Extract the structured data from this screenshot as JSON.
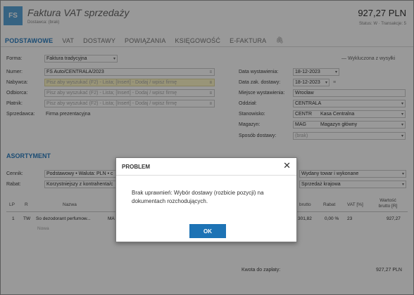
{
  "header": {
    "logo": "FS",
    "title": "Faktura VAT sprzedaży",
    "status": "Dostawca: (brak)",
    "amount": "927,27 PLN",
    "amount_sub": "Status: W · Transakcje: 5"
  },
  "tabs": [
    {
      "label": "PODSTAWOWE"
    },
    {
      "label": "VAT"
    },
    {
      "label": "DOSTAWY"
    },
    {
      "label": "POWIĄZANIA"
    },
    {
      "label": "KSIĘGOWOŚĆ"
    },
    {
      "label": "E-FAKTURA"
    }
  ],
  "left_form": {
    "forma_label": "Forma:",
    "forma_value": "Faktura tradycyjna",
    "numer_label": "Numer:",
    "numer_value": "FS Auto/CENTRALA/2023",
    "nabywca_label": "Nabywca:",
    "nabywca_placeholder": "Pisz aby wyszukać (F2) - Lista; [Insert] - Dodaj / wpisz firmę",
    "odbiorca_label": "Odbiorca:",
    "odbiorca_placeholder": "Pisz aby wyszukać (F2) - Lista; [Insert] - Dodaj / wpisz firmę",
    "platnik_label": "Płatnik:",
    "platnik_placeholder": "Pisz aby wyszukać (F2) - Lista; [Insert] - Dodaj / wpisz firmę",
    "sprzedawca_label": "Sprzedawca:",
    "sprzedawca_value": "Firma prezentacyjna"
  },
  "right_form": {
    "wykluczona": "— Wykluczona z wysyłki",
    "data_wyst_label": "Data wystawienia:",
    "data_wyst_value": "18-12-2023",
    "data_zak_label": "Data zak. dostawy:",
    "data_zak_value": "18-12-2023",
    "miejsce_label": "Miejsce wystawienia:",
    "miejsce_value": "Wrocław",
    "oddzial_label": "Oddział:",
    "oddzial_value": "CENTRALA",
    "stanowisko_label": "Stanowisko:",
    "stanowisko_code": "CENTR",
    "stanowisko_value": "Kasa Centralna",
    "magazyn_label": "Magazyn:",
    "magazyn_code": "MAG",
    "magazyn_value": "Magazyn główny",
    "sposob_label": "Sposób dostawy:",
    "sposob_value": "(brak)"
  },
  "assortment": {
    "title": "ASORTYMENT",
    "cennik_label": "Cennik:",
    "cennik_value": "Podstawowy • Waluta: PLN • c",
    "rabat_label": "Rabat:",
    "rabat_value": "Korzystniejszy z kontrahenta/c",
    "wydany_value": "Wydany towar i wykonane",
    "sprzedaz_value": "Sprzedaż krajowa",
    "columns": [
      "LP",
      "R",
      "Nazwa",
      "brutto",
      "Rabat",
      "VAT [%]",
      "Wartość brutto [R]"
    ],
    "row": {
      "lp": "1",
      "r": "TW",
      "nazwa": "So dezodorant perfumow...",
      "kod": "MA",
      "brutto": "301,82",
      "rabat": "0,00 %",
      "vat": "23",
      "wartosc": "927,27"
    },
    "nowa": "Nowa",
    "kwota_label": "Kwota do zapłaty:",
    "kwota_value": "927,27 PLN"
  },
  "dialog": {
    "title": "PROBLEM",
    "close": "✕",
    "message": "Brak uprawnień: Wybór dostawy (rozbicie pozycji) na dokumentach rozchodujących.",
    "ok": "OK"
  }
}
